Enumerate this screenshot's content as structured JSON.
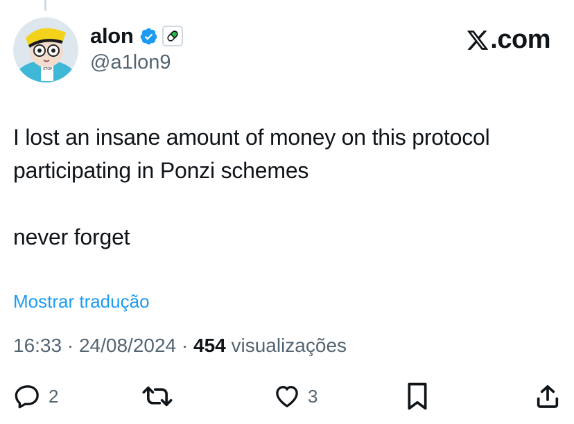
{
  "author": {
    "display_name": "alon",
    "handle": "@a1lon9",
    "avatar_icon": "avatar-cartoon-character-hat-sunglasses",
    "badges": [
      "verified-icon",
      "pill-icon"
    ]
  },
  "brand": {
    "label": ".com",
    "logo_icon": "x-logo-icon"
  },
  "tweet": {
    "lines": [
      "I lost an insane amount of money on this protocol participating in Ponzi schemes",
      "never forget"
    ]
  },
  "translate": {
    "label": "Mostrar tradução"
  },
  "meta": {
    "time": "16:33",
    "separator": "·",
    "date": "24/08/2024",
    "views_count": "454",
    "views_label": "visualizações"
  },
  "actions": {
    "reply_count": "2",
    "retweet_count": "",
    "like_count": "3"
  },
  "colors": {
    "accent": "#1d9bf0",
    "text": "#0f1419",
    "muted": "#536471"
  }
}
